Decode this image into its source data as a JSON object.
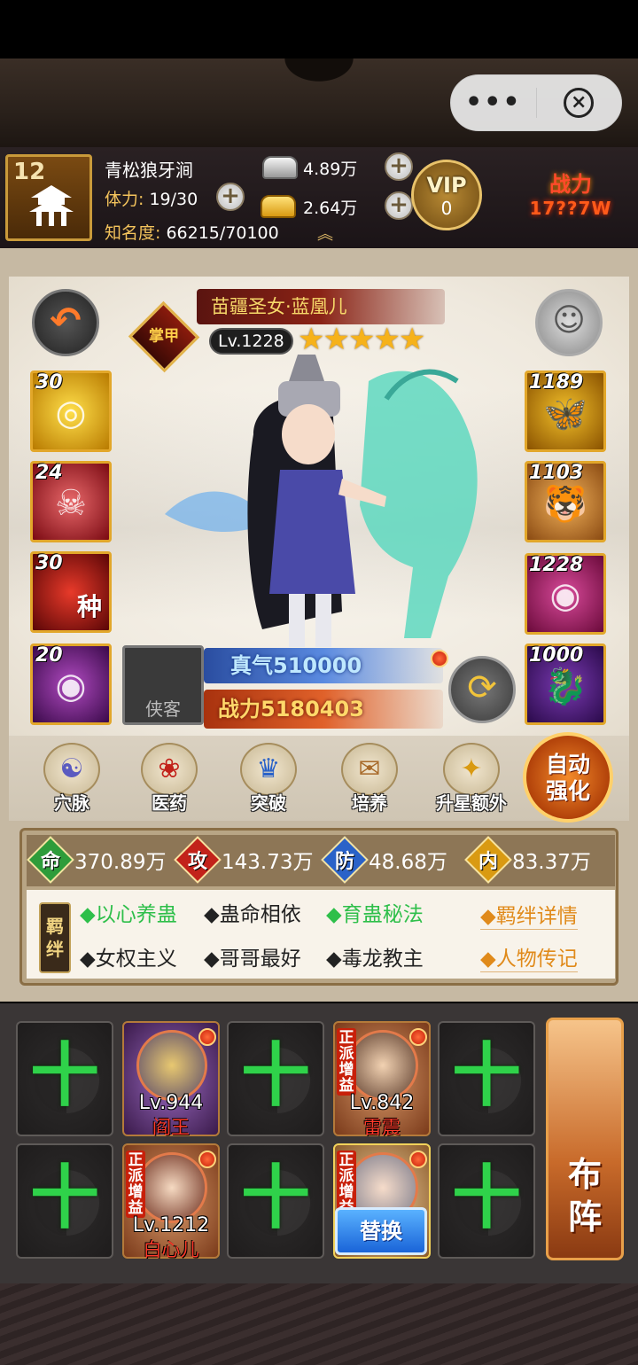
{
  "capsule": {
    "more": "•••",
    "close": "×"
  },
  "player": {
    "level": "12",
    "name": "青松狼牙涧",
    "stamina_label": "体力:",
    "stamina_value": "19/30",
    "fame_label": "知名度:",
    "fame_value": "66215/70100",
    "silver": "4.89万",
    "gold": "2.64万",
    "vip_label": "VIP",
    "vip_level": "0",
    "power_label": "战力",
    "power_value": "17??7W"
  },
  "hero": {
    "name": "苗疆圣女·蓝凰儿",
    "rank_badge": "掌甲",
    "level": "Lv.1228",
    "stars": 5,
    "stars_text": "★★★★★",
    "zhenqi": "真气510000",
    "power": "战力5180403",
    "slot_label": "侠客"
  },
  "skills_left": [
    {
      "num": "30",
      "glyph": "◎",
      "tag": ""
    },
    {
      "num": "24",
      "glyph": "☠",
      "tag": ""
    },
    {
      "num": "30",
      "glyph": "",
      "tag": "种"
    },
    {
      "num": "20",
      "glyph": "◉",
      "tag": ""
    }
  ],
  "skills_right": [
    {
      "num": "1189",
      "glyph": "🦋"
    },
    {
      "num": "1103",
      "glyph": "🐯"
    },
    {
      "num": "1228",
      "glyph": "◉"
    },
    {
      "num": "1000",
      "glyph": "🐉"
    }
  ],
  "functions": [
    {
      "label": "穴脉",
      "icon": "meditation-icon",
      "glyph": "☯"
    },
    {
      "label": "医药",
      "icon": "herb-icon",
      "glyph": "❀"
    },
    {
      "label": "突破",
      "icon": "breakthrough-icon",
      "glyph": "♛"
    },
    {
      "label": "培养",
      "icon": "scroll-icon",
      "glyph": "✉"
    },
    {
      "label": "升星额外",
      "icon": "chest-icon",
      "glyph": "✦"
    }
  ],
  "auto": {
    "line1": "自动",
    "line2": "强化"
  },
  "stats": [
    {
      "key": "命",
      "value": "370.89万",
      "color": "#2e9c3a"
    },
    {
      "key": "攻",
      "value": "143.73万",
      "color": "#c2221a"
    },
    {
      "key": "防",
      "value": "48.68万",
      "color": "#2a62c8"
    },
    {
      "key": "内",
      "value": "83.37万",
      "color": "#d99a12"
    }
  ],
  "bond": {
    "tag": "羁绊",
    "items": [
      {
        "text": "◆以心养蛊",
        "active": true
      },
      {
        "text": "◆蛊命相依",
        "active": false
      },
      {
        "text": "◆育蛊秘法",
        "active": true
      },
      {
        "text": "◆女权主义",
        "active": false
      },
      {
        "text": "◆哥哥最好",
        "active": false
      },
      {
        "text": "◆毒龙教主",
        "active": false
      }
    ],
    "detail_link": "◆羁绊详情",
    "bio_link": "◆人物传记"
  },
  "lineup": {
    "empty_symbol": "十",
    "members": [
      {
        "level": "Lv.944",
        "name": "阎王",
        "tag": ""
      },
      {
        "level": "Lv.842",
        "name": "雷震",
        "tag": "正派增益"
      },
      {
        "level": "Lv.1212",
        "name": "白心儿",
        "tag": "正派增益"
      },
      {
        "tag": "正派增益"
      }
    ],
    "replace_label": "替换",
    "formation_line1": "布",
    "formation_line2": "阵"
  },
  "colors": {
    "accent_gold": "#e2a72a",
    "power_red": "#ff4a2a",
    "bond_active": "#2ebf4a",
    "bond_link": "#e08a1a",
    "plus_green": "#2fd24a"
  }
}
